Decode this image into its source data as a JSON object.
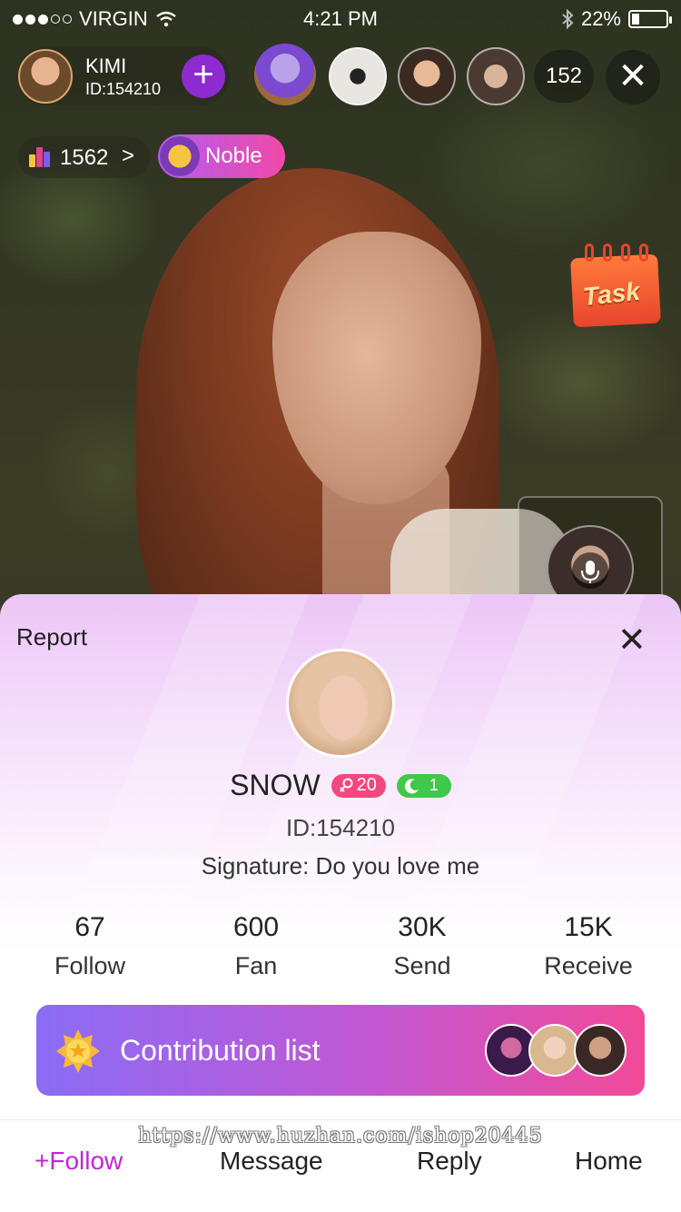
{
  "status_bar": {
    "carrier": "VIRGIN",
    "time": "4:21 PM",
    "battery": "22%",
    "battery_level": 0.22
  },
  "host": {
    "name": "KIMI",
    "id": "ID:154210",
    "add_label": "+"
  },
  "viewers": {
    "count": "152",
    "close_label": "✕"
  },
  "ranking": {
    "value": "1562",
    "chevron": ">"
  },
  "noble": {
    "label": "Noble"
  },
  "task": {
    "label": "Task"
  },
  "profile": {
    "report": "Report",
    "close_label": "✕",
    "name": "SNOW",
    "level_badge": "20",
    "moon_badge": "1",
    "id": "ID:154210",
    "signature": "Signature: Do you love me",
    "stats": [
      {
        "value": "67",
        "label": "Follow"
      },
      {
        "value": "600",
        "label": "Fan"
      },
      {
        "value": "30K",
        "label": "Send"
      },
      {
        "value": "15K",
        "label": "Receive"
      }
    ],
    "contribution_title": "Contribution list"
  },
  "watermark": "https://www.huzhan.com/ishop20445",
  "actions": {
    "follow": "+Follow",
    "message": "Message",
    "reply": "Reply",
    "home": "Home"
  },
  "colors": {
    "accent_purple": "#8e2bd0",
    "follow_magenta": "#c026d3",
    "level_pink": "#f5477f",
    "moon_green": "#3fc84a"
  }
}
